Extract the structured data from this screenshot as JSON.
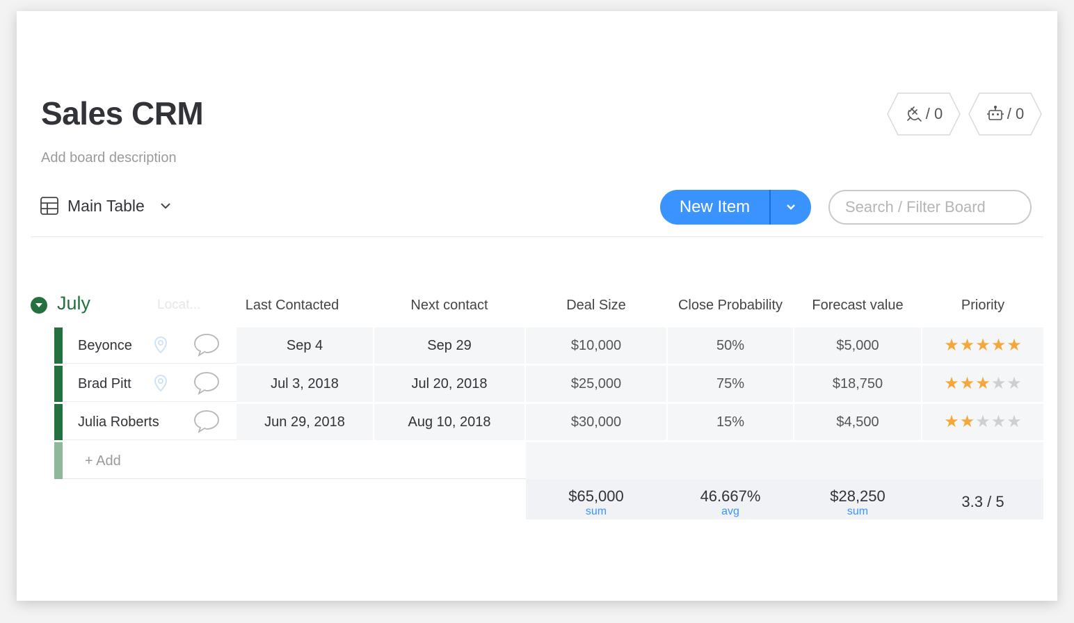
{
  "board": {
    "title": "Sales CRM",
    "description_placeholder": "Add board description",
    "integrations_count": "/ 0",
    "automations_count": "/ 0"
  },
  "toolbar": {
    "view_label": "Main Table",
    "new_item_label": "New Item",
    "search_placeholder": "Search / Filter Board"
  },
  "group": {
    "name": "July",
    "color": "#22713f",
    "ghost_column": "Locat...",
    "columns": [
      "Last Contacted",
      "Next contact",
      "Deal Size",
      "Close Probability",
      "Forecast value",
      "Priority"
    ],
    "rows": [
      {
        "name": "Beyonce",
        "last_contacted": "Sep 4",
        "next_contact": "Sep 29",
        "deal_size": "$10,000",
        "close_probability": "50%",
        "forecast_value": "$5,000",
        "priority": 5
      },
      {
        "name": "Brad Pitt",
        "last_contacted": "Jul 3, 2018",
        "next_contact": "Jul 20, 2018",
        "deal_size": "$25,000",
        "close_probability": "75%",
        "forecast_value": "$18,750",
        "priority": 3
      },
      {
        "name": "Julia Roberts",
        "last_contacted": "Jun 29, 2018",
        "next_contact": "Aug 10, 2018",
        "deal_size": "$30,000",
        "close_probability": "15%",
        "forecast_value": "$4,500",
        "priority": 2
      }
    ],
    "add_label": "+ Add",
    "summary": {
      "deal_size": {
        "value": "$65,000",
        "fn": "sum"
      },
      "close_probability": {
        "value": "46.667%",
        "fn": "avg"
      },
      "forecast_value": {
        "value": "$28,250",
        "fn": "sum"
      },
      "priority": {
        "value": "3.3 / 5"
      }
    }
  },
  "colors": {
    "accent": "#3b93ff",
    "star": "#f6a73a",
    "group": "#22713f"
  }
}
